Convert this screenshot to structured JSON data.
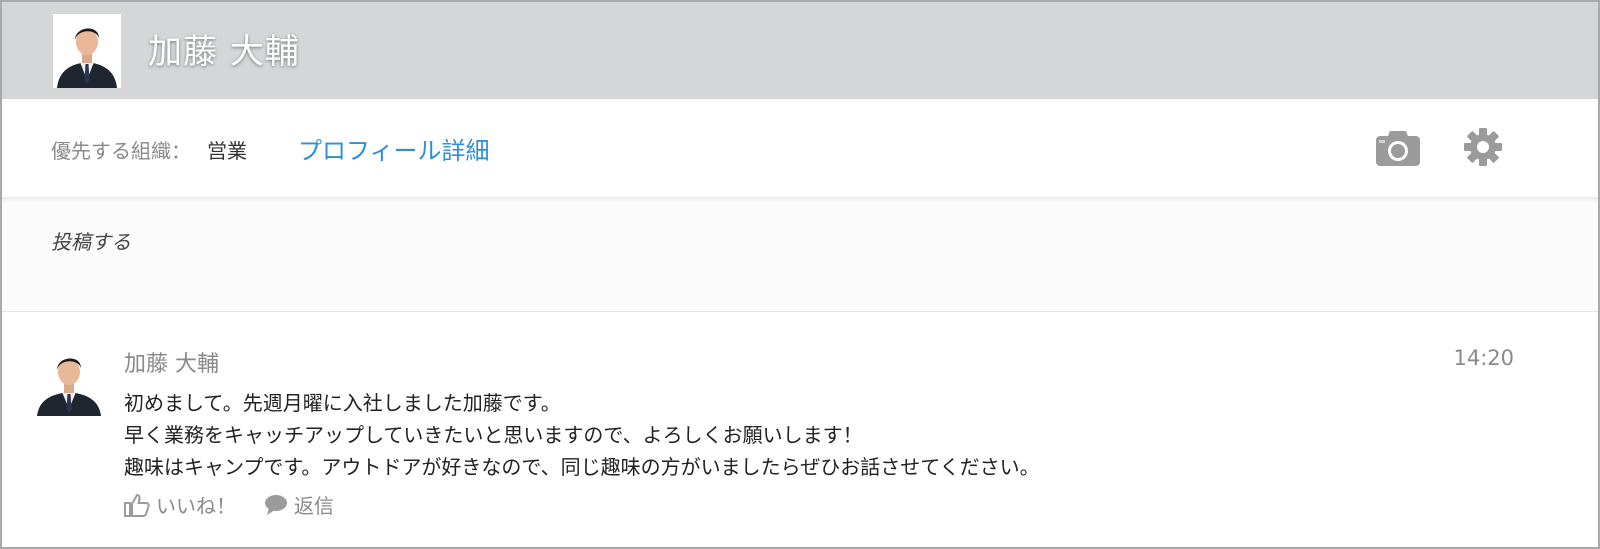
{
  "header": {
    "user_name": "加藤 大輔",
    "avatar_icon": "user-photo-icon"
  },
  "infobar": {
    "org_label": "優先する組織：",
    "org_value": "営業",
    "profile_link": "プロフィール詳細",
    "camera_icon": "camera-icon",
    "settings_icon": "gear-icon",
    "link_color": "#2d8fd9"
  },
  "composer": {
    "placeholder": "投稿する"
  },
  "feed": [
    {
      "author": "加藤 大輔",
      "time": "14:20",
      "lines": [
        "初めまして。先週月曜に入社しました加藤です。",
        "早く業務をキャッチアップしていきたいと思いますので、よろしくお願いします！",
        "趣味はキャンプです。アウトドアが好きなので、同じ趣味の方がいましたらぜひお話させてください。"
      ],
      "like_label": "いいね！",
      "reply_label": "返信",
      "like_icon": "thumbs-up-icon",
      "reply_icon": "speech-bubble-icon"
    }
  ]
}
